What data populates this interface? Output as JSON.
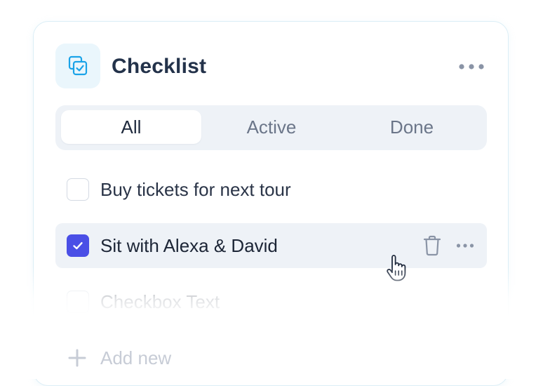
{
  "header": {
    "title": "Checklist",
    "icon": "checklist-icon",
    "more_icon": "more-horizontal-icon"
  },
  "tabs": [
    {
      "label": "All",
      "selected": true
    },
    {
      "label": "Active",
      "selected": false
    },
    {
      "label": "Done",
      "selected": false
    }
  ],
  "items": [
    {
      "label": "Buy tickets for next tour",
      "checked": false
    },
    {
      "label": "Sit with Alexa & David",
      "checked": true,
      "hovered": true
    },
    {
      "label": "Checkbox Text",
      "checked": false
    }
  ],
  "row_actions": {
    "delete_icon": "trash-icon",
    "more_icon": "more-horizontal-icon"
  },
  "add_new": {
    "label": "Add new",
    "icon": "plus-icon"
  },
  "colors": {
    "accent": "#4a4fe6",
    "icon_blue": "#1aa3e8",
    "tab_bg": "#eef2f7",
    "card_border": "#dbeef6"
  }
}
